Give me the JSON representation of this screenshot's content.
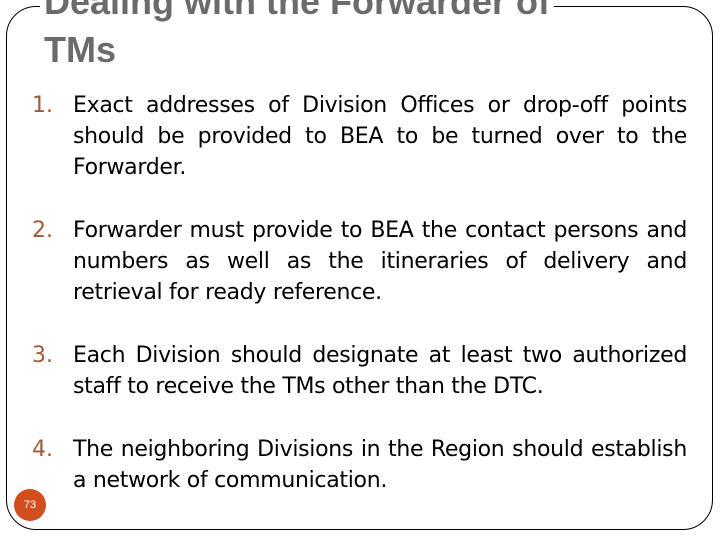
{
  "slide": {
    "title_line1": "Dealing with the Forwarder of",
    "title_line2": "TMs",
    "items": [
      {
        "number": "1.",
        "text": "Exact addresses of Division Offices or drop-off points should be provided to BEA to be turned over to the Forwarder."
      },
      {
        "number": "2.",
        "text": "Forwarder must provide to BEA the contact persons and numbers as well as the itineraries of delivery and retrieval for ready reference."
      },
      {
        "number": "3.",
        "text": "Each Division should designate at least two authorized staff to receive the TMs other than the DTC."
      },
      {
        "number": "4.",
        "text": "The neighboring Divisions in the Region should establish a network of communication."
      }
    ],
    "page_number": "73"
  },
  "colors": {
    "title": "#6b6b6b",
    "number": "#a05a3a",
    "badge": "#d24e1e"
  }
}
